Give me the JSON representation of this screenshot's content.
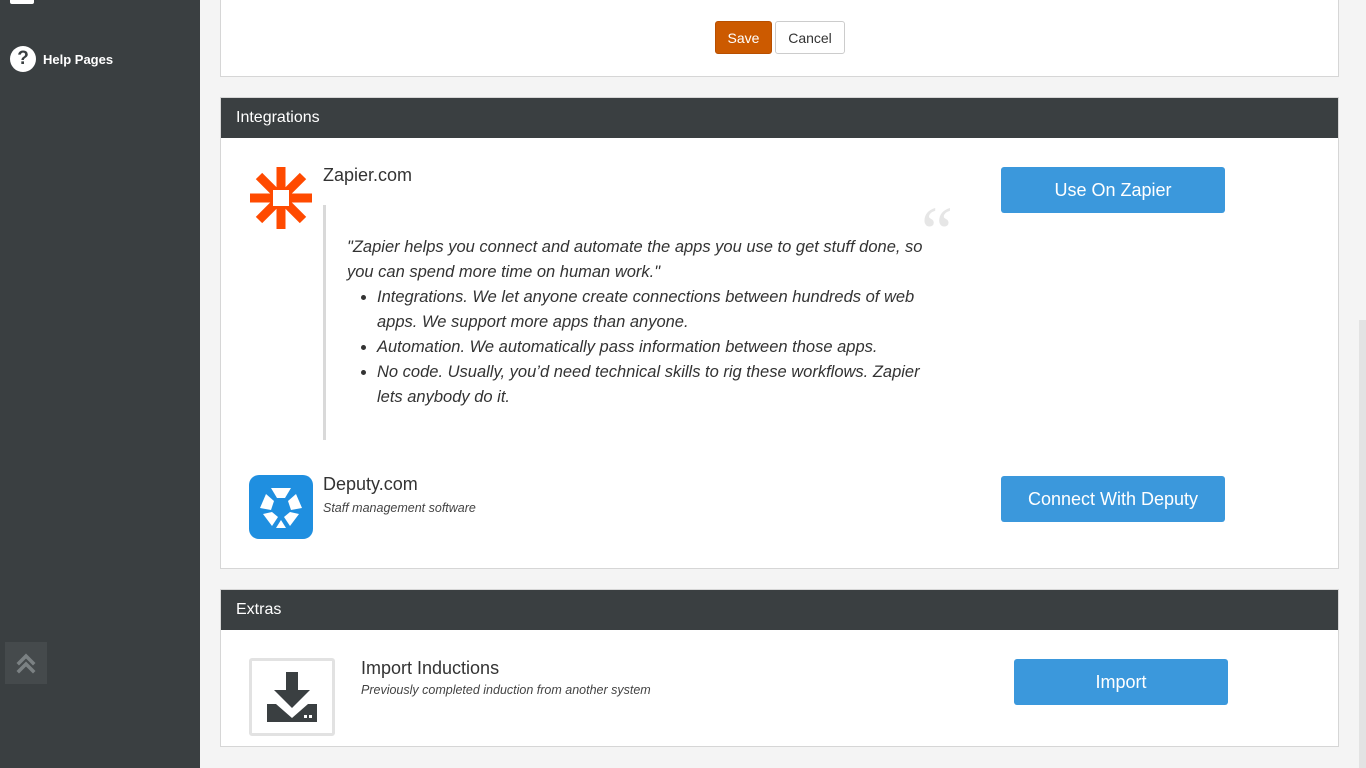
{
  "sidebar": {
    "help_label": "Help Pages",
    "help_icon": "question-circle-icon",
    "scroll_top_icon": "double-chevron-up-icon"
  },
  "top_panel": {
    "save_label": "Save",
    "cancel_label": "Cancel"
  },
  "integrations": {
    "header": "Integrations",
    "zapier": {
      "name": "Zapier.com",
      "logo_icon": "zapier-asterisk-icon",
      "quote": "\"Zapier helps you connect and automate the apps you use to get stuff done, so you can spend more time on human work.\"",
      "bullets": [
        "Integrations. We let anyone create connections between hundreds of web apps. We support more apps than anyone.",
        "Automation. We automatically pass information between those apps.",
        "No code. Usually, you’d need technical skills to rig these workflows. Zapier lets anybody do it."
      ],
      "quote_mark": "“",
      "button_label": "Use On Zapier"
    },
    "deputy": {
      "name": "Deputy.com",
      "logo_icon": "deputy-logo-icon",
      "description": "Staff management software",
      "button_label": "Connect With Deputy"
    }
  },
  "extras": {
    "header": "Extras",
    "import": {
      "icon": "download-tray-icon",
      "name": "Import Inductions",
      "description": "Previously completed induction from another system",
      "button_label": "Import"
    }
  },
  "colors": {
    "sidebar_bg": "#3a3f41",
    "save_orange": "#cc5a00",
    "button_blue": "#3b98dc",
    "zapier_orange": "#ff4a00",
    "deputy_blue": "#1f8fe0"
  }
}
